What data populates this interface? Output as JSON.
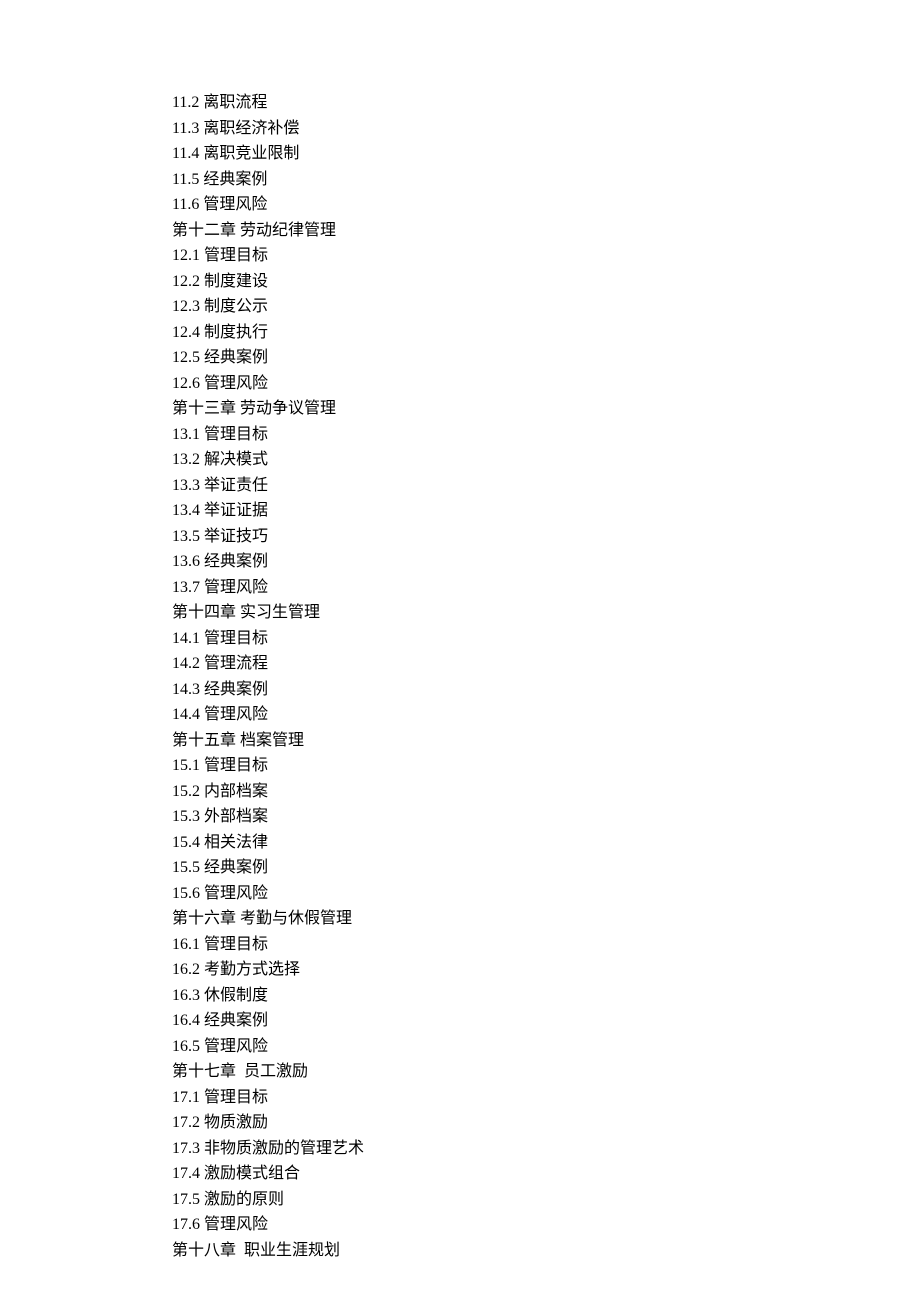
{
  "toc": {
    "lines": [
      "11.2 离职流程",
      "11.3 离职经济补偿",
      "11.4 离职竞业限制",
      "11.5 经典案例",
      "11.6 管理风险",
      "第十二章 劳动纪律管理",
      "12.1 管理目标",
      "12.2 制度建设",
      "12.3 制度公示",
      "12.4 制度执行",
      "12.5 经典案例",
      "12.6 管理风险",
      "第十三章 劳动争议管理",
      "13.1 管理目标",
      "13.2 解决模式",
      "13.3 举证责任",
      "13.4 举证证据",
      "13.5 举证技巧",
      "13.6 经典案例",
      "13.7 管理风险",
      "第十四章 实习生管理",
      "14.1 管理目标",
      "14.2 管理流程",
      "14.3 经典案例",
      "14.4 管理风险",
      "第十五章 档案管理",
      "15.1 管理目标",
      "15.2 内部档案",
      "15.3 外部档案",
      "15.4 相关法律",
      "15.5 经典案例",
      "15.6 管理风险",
      "第十六章 考勤与休假管理",
      "16.1 管理目标",
      "16.2 考勤方式选择",
      "16.3 休假制度",
      "16.4 经典案例",
      "16.5 管理风险",
      "第十七章  员工激励",
      "17.1 管理目标",
      "17.2 物质激励",
      "17.3 非物质激励的管理艺术",
      "17.4 激励模式组合",
      "17.5 激励的原则",
      "17.6 管理风险",
      "第十八章  职业生涯规划"
    ]
  }
}
